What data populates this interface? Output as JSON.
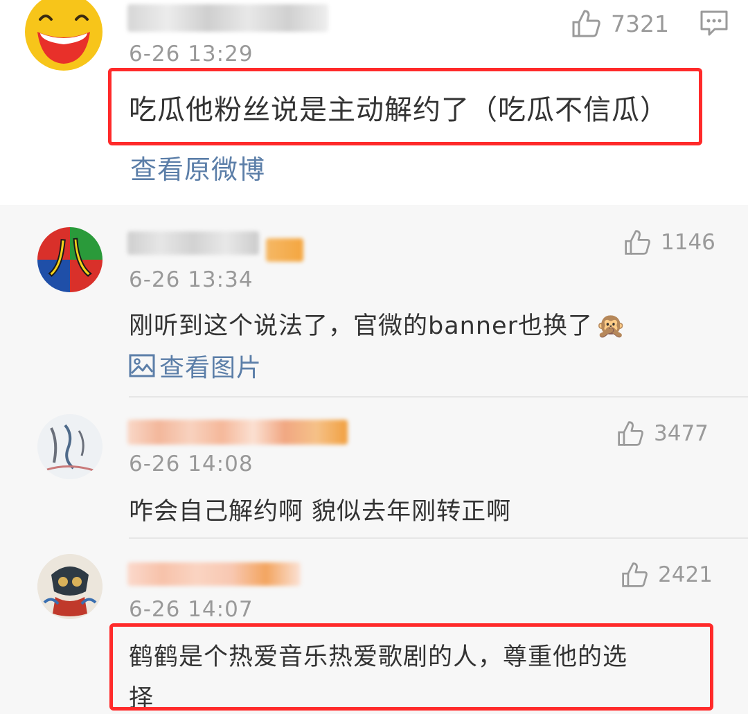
{
  "main_comment": {
    "time": "6-26 13:29",
    "likes": "7321",
    "text": "吃瓜他粉丝说是主动解约了（吃瓜不信瓜）",
    "link": "查看原微博"
  },
  "replies": [
    {
      "time": "6-26 13:34",
      "likes": "1146",
      "text": "刚听到这个说法了，官微的banner也换了",
      "emoji": "🙊",
      "link": "查看图片"
    },
    {
      "time": "6-26 14:08",
      "likes": "3477",
      "text": "咋会自己解约啊 貌似去年刚转正啊"
    },
    {
      "time": "6-26 14:07",
      "likes": "2421",
      "text_line1": "鹤鹤是个热爱音乐热爱歌剧的人，尊重他的选",
      "text_line2": "择"
    }
  ],
  "avatar_letters": {
    "reply0": "八"
  },
  "colors": {
    "highlight_box": "#ff2a2a",
    "link": "#5b7ea8",
    "meta_gray": "#999999"
  }
}
